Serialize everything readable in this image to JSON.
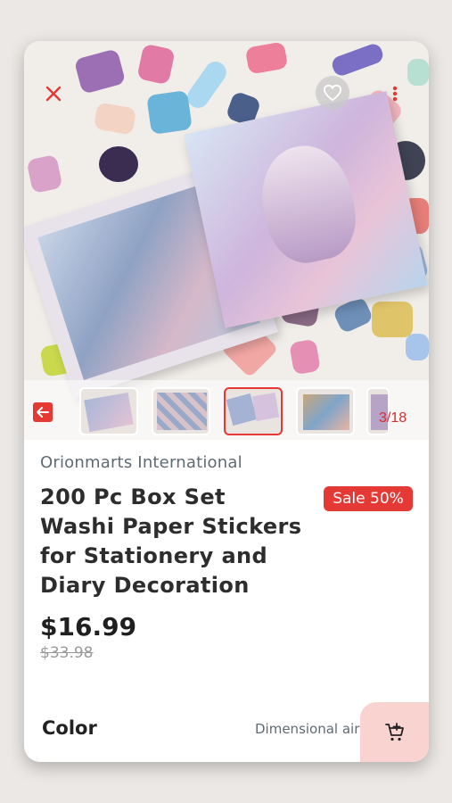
{
  "product": {
    "seller": "Orionmarts International",
    "title": "200 Pc Box Set Washi Paper Stickers for Stationery and Diary Decoration",
    "sale_badge": "Sale 50%",
    "price": "$16.99",
    "original_price": "$33.98"
  },
  "gallery": {
    "counter": "3/18",
    "selected_index": 3,
    "thumb_count_visible": 5
  },
  "options": {
    "color_label": "Color",
    "color_value": "Dimensional air wave"
  },
  "icons": {
    "close": "close-icon",
    "favorite": "heart-icon",
    "more": "more-vertical-icon",
    "back": "arrow-left-icon",
    "cart": "add-to-cart-icon"
  },
  "colors": {
    "accent": "#e53935",
    "cart_bg": "#f8d3d0"
  }
}
